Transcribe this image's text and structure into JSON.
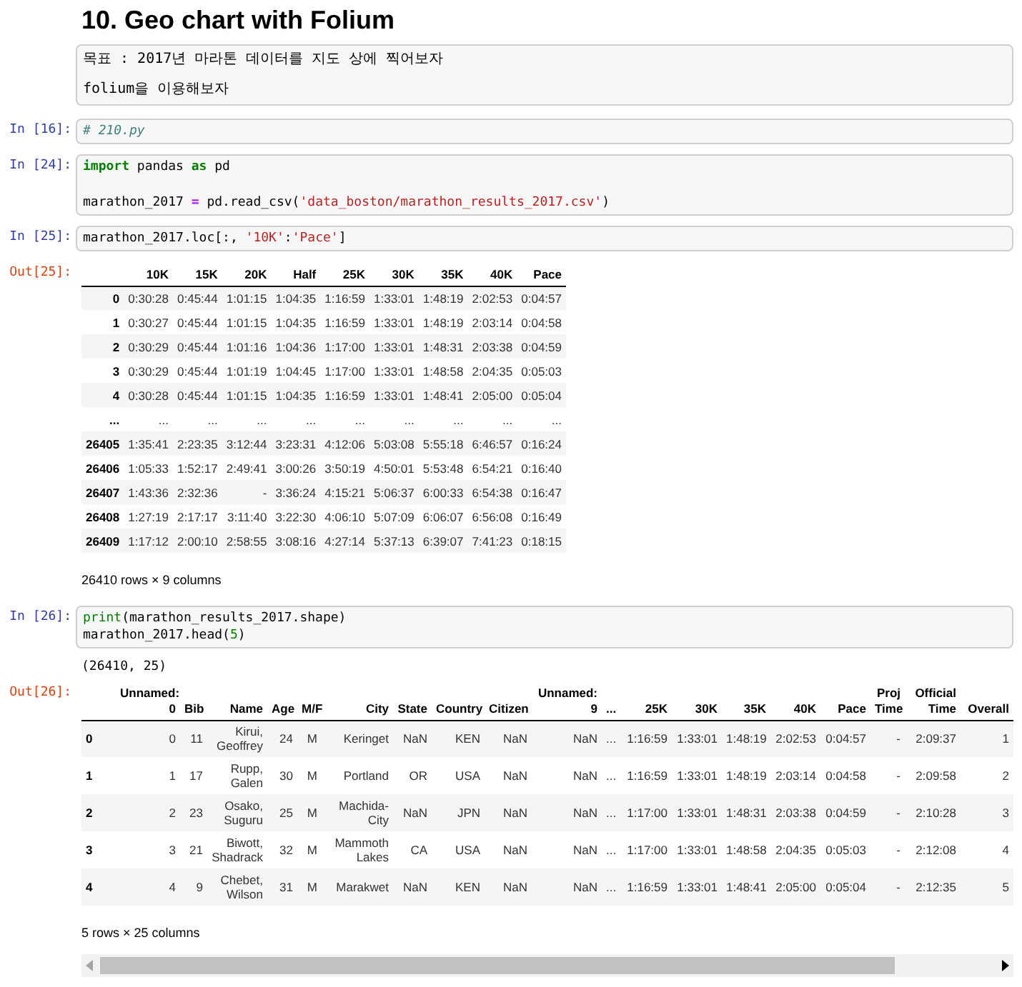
{
  "heading": "10. Geo chart with Folium",
  "cells": [
    {
      "kind": "markdown",
      "paragraphs": [
        "목표 : 2017년 마라톤 데이터를 지도 상에 찍어보자",
        "folium을 이용해보자"
      ]
    },
    {
      "kind": "code",
      "prompt": "In [16]:",
      "lines": [
        {
          "gap_before": false,
          "tokens": [
            {
              "kind": "comment",
              "text": "# 210.py"
            }
          ]
        }
      ]
    },
    {
      "kind": "code",
      "prompt": "In [24]:",
      "lines": [
        {
          "gap_before": false,
          "tokens": [
            {
              "kind": "keyword",
              "text": "import"
            },
            {
              "kind": "plain",
              "text": " pandas "
            },
            {
              "kind": "keyword",
              "text": "as"
            },
            {
              "kind": "plain",
              "text": " pd"
            }
          ]
        },
        {
          "gap_before": true,
          "tokens": [
            {
              "kind": "plain",
              "text": "marathon_2017 "
            },
            {
              "kind": "operator",
              "text": "="
            },
            {
              "kind": "plain",
              "text": " pd.read_csv("
            },
            {
              "kind": "string",
              "text": "'data_boston/marathon_results_2017.csv'"
            },
            {
              "kind": "plain",
              "text": ")"
            }
          ]
        }
      ]
    },
    {
      "kind": "code",
      "prompt": "In [25]:",
      "lines": [
        {
          "gap_before": false,
          "tokens": [
            {
              "kind": "plain",
              "text": "marathon_2017.loc[:, "
            },
            {
              "kind": "string",
              "text": "'10K'"
            },
            {
              "kind": "plain",
              "text": ":"
            },
            {
              "kind": "string",
              "text": "'Pace'"
            },
            {
              "kind": "plain",
              "text": "]"
            }
          ]
        }
      ]
    },
    {
      "kind": "table",
      "prompt": "Out[25]:",
      "columns": [
        "10K",
        "15K",
        "20K",
        "Half",
        "25K",
        "30K",
        "35K",
        "40K",
        "Pace"
      ],
      "rows": [
        {
          "index": "0",
          "cells": [
            "0:30:28",
            "0:45:44",
            "1:01:15",
            "1:04:35",
            "1:16:59",
            "1:33:01",
            "1:48:19",
            "2:02:53",
            "0:04:57"
          ]
        },
        {
          "index": "1",
          "cells": [
            "0:30:27",
            "0:45:44",
            "1:01:15",
            "1:04:35",
            "1:16:59",
            "1:33:01",
            "1:48:19",
            "2:03:14",
            "0:04:58"
          ]
        },
        {
          "index": "2",
          "cells": [
            "0:30:29",
            "0:45:44",
            "1:01:16",
            "1:04:36",
            "1:17:00",
            "1:33:01",
            "1:48:31",
            "2:03:38",
            "0:04:59"
          ]
        },
        {
          "index": "3",
          "cells": [
            "0:30:29",
            "0:45:44",
            "1:01:19",
            "1:04:45",
            "1:17:00",
            "1:33:01",
            "1:48:58",
            "2:04:35",
            "0:05:03"
          ]
        },
        {
          "index": "4",
          "cells": [
            "0:30:28",
            "0:45:44",
            "1:01:15",
            "1:04:35",
            "1:16:59",
            "1:33:01",
            "1:48:41",
            "2:05:00",
            "0:05:04"
          ]
        },
        {
          "index": "...",
          "cells": [
            "...",
            "...",
            "...",
            "...",
            "...",
            "...",
            "...",
            "...",
            "..."
          ]
        },
        {
          "index": "26405",
          "cells": [
            "1:35:41",
            "2:23:35",
            "3:12:44",
            "3:23:31",
            "4:12:06",
            "5:03:08",
            "5:55:18",
            "6:46:57",
            "0:16:24"
          ]
        },
        {
          "index": "26406",
          "cells": [
            "1:05:33",
            "1:52:17",
            "2:49:41",
            "3:00:26",
            "3:50:19",
            "4:50:01",
            "5:53:48",
            "6:54:21",
            "0:16:40"
          ]
        },
        {
          "index": "26407",
          "cells": [
            "1:43:36",
            "2:32:36",
            "-",
            "3:36:24",
            "4:15:21",
            "5:06:37",
            "6:00:33",
            "6:54:38",
            "0:16:47"
          ]
        },
        {
          "index": "26408",
          "cells": [
            "1:27:19",
            "2:17:17",
            "3:11:40",
            "3:22:30",
            "4:06:10",
            "5:07:09",
            "6:06:07",
            "6:56:08",
            "0:16:49"
          ]
        },
        {
          "index": "26409",
          "cells": [
            "1:17:12",
            "2:00:10",
            "2:58:55",
            "3:08:16",
            "4:27:14",
            "5:37:13",
            "6:39:07",
            "7:41:23",
            "0:18:15"
          ]
        }
      ],
      "footer": "26410 rows × 9 columns",
      "scrollbar": false
    },
    {
      "kind": "code",
      "prompt": "In [26]:",
      "lines": [
        {
          "gap_before": false,
          "tokens": [
            {
              "kind": "builtin",
              "text": "print"
            },
            {
              "kind": "plain",
              "text": "(marathon_results_2017.shape)"
            }
          ]
        },
        {
          "gap_before": false,
          "tokens": [
            {
              "kind": "plain",
              "text": "marathon_2017.head("
            },
            {
              "kind": "number",
              "text": "5"
            },
            {
              "kind": "plain",
              "text": ")"
            }
          ]
        }
      ]
    },
    {
      "kind": "stream",
      "text": "(26410, 25)"
    },
    {
      "kind": "table",
      "prompt": "Out[26]:",
      "columns": [
        "Unnamed: 0",
        "Bib",
        "Name",
        "Age",
        "M/F",
        "City",
        "State",
        "Country",
        "Citizen",
        "Unnamed: 9",
        "...",
        "25K",
        "30K",
        "35K",
        "40K",
        "Pace",
        "Proj Time",
        "Official Time",
        "Overall"
      ],
      "rows": [
        {
          "index": "0",
          "cells": [
            "0",
            "11",
            "Kirui, Geoffrey",
            "24",
            "M",
            "Keringet",
            "NaN",
            "KEN",
            "NaN",
            "NaN",
            "...",
            "1:16:59",
            "1:33:01",
            "1:48:19",
            "2:02:53",
            "0:04:57",
            "-",
            "2:09:37",
            "1"
          ]
        },
        {
          "index": "1",
          "cells": [
            "1",
            "17",
            "Rupp, Galen",
            "30",
            "M",
            "Portland",
            "OR",
            "USA",
            "NaN",
            "NaN",
            "...",
            "1:16:59",
            "1:33:01",
            "1:48:19",
            "2:03:14",
            "0:04:58",
            "-",
            "2:09:58",
            "2"
          ]
        },
        {
          "index": "2",
          "cells": [
            "2",
            "23",
            "Osako, Suguru",
            "25",
            "M",
            "Machida-City",
            "NaN",
            "JPN",
            "NaN",
            "NaN",
            "...",
            "1:17:00",
            "1:33:01",
            "1:48:31",
            "2:03:38",
            "0:04:59",
            "-",
            "2:10:28",
            "3"
          ]
        },
        {
          "index": "3",
          "cells": [
            "3",
            "21",
            "Biwott, Shadrack",
            "32",
            "M",
            "Mammoth Lakes",
            "CA",
            "USA",
            "NaN",
            "NaN",
            "...",
            "1:17:00",
            "1:33:01",
            "1:48:58",
            "2:04:35",
            "0:05:03",
            "-",
            "2:12:08",
            "4"
          ]
        },
        {
          "index": "4",
          "cells": [
            "4",
            "9",
            "Chebet, Wilson",
            "31",
            "M",
            "Marakwet",
            "NaN",
            "KEN",
            "NaN",
            "NaN",
            "...",
            "1:16:59",
            "1:33:01",
            "1:48:41",
            "2:05:00",
            "0:05:04",
            "-",
            "2:12:35",
            "5"
          ]
        }
      ],
      "footer": "5 rows × 25 columns",
      "scrollbar": true
    }
  ]
}
